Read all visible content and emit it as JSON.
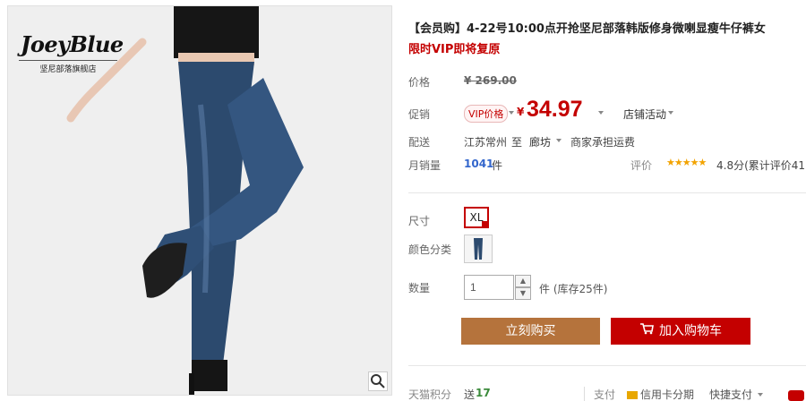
{
  "product": {
    "brand": "JoeyBlue",
    "brand_sub": "坚尼部落旗舰店",
    "title": "【会员购】4-22号10:00点开抢坚尼部落韩版修身微喇显瘦牛仔裤女",
    "subtitle": "限时VIP即将复原"
  },
  "price": {
    "label": "价格",
    "original": "¥ 269.00",
    "promo_label": "促销",
    "vip_tag": "VIP价格",
    "currency": "¥",
    "current": "34.97",
    "promo_activity": "店铺活动"
  },
  "shipping": {
    "label": "配送",
    "from": "江苏常州",
    "to_word": "至",
    "to": "廊坊",
    "fee_note": "商家承担运费"
  },
  "sales": {
    "label": "月销量",
    "count": "1041",
    "unit": "件",
    "rating_label": "评价",
    "stars": "★★★★★",
    "score": "4.8分(累计评价41)"
  },
  "options": {
    "size_label": "尺寸",
    "size_value": "XL",
    "color_label": "颜色分类"
  },
  "quantity": {
    "label": "数量",
    "value": "1",
    "stock": "件 (库存25件)"
  },
  "buttons": {
    "buy_now": "立刻购买",
    "add_cart": "加入购物车"
  },
  "bottom": {
    "points_label": "天猫积分",
    "points_prefix": "送",
    "points_value": "17",
    "pay_label": "支付",
    "credit": "信用卡分期",
    "quick_pay": "快捷支付"
  },
  "colors": {
    "accent": "#c40000",
    "buy_button": "#b5733c",
    "cart_button": "#c40000"
  }
}
